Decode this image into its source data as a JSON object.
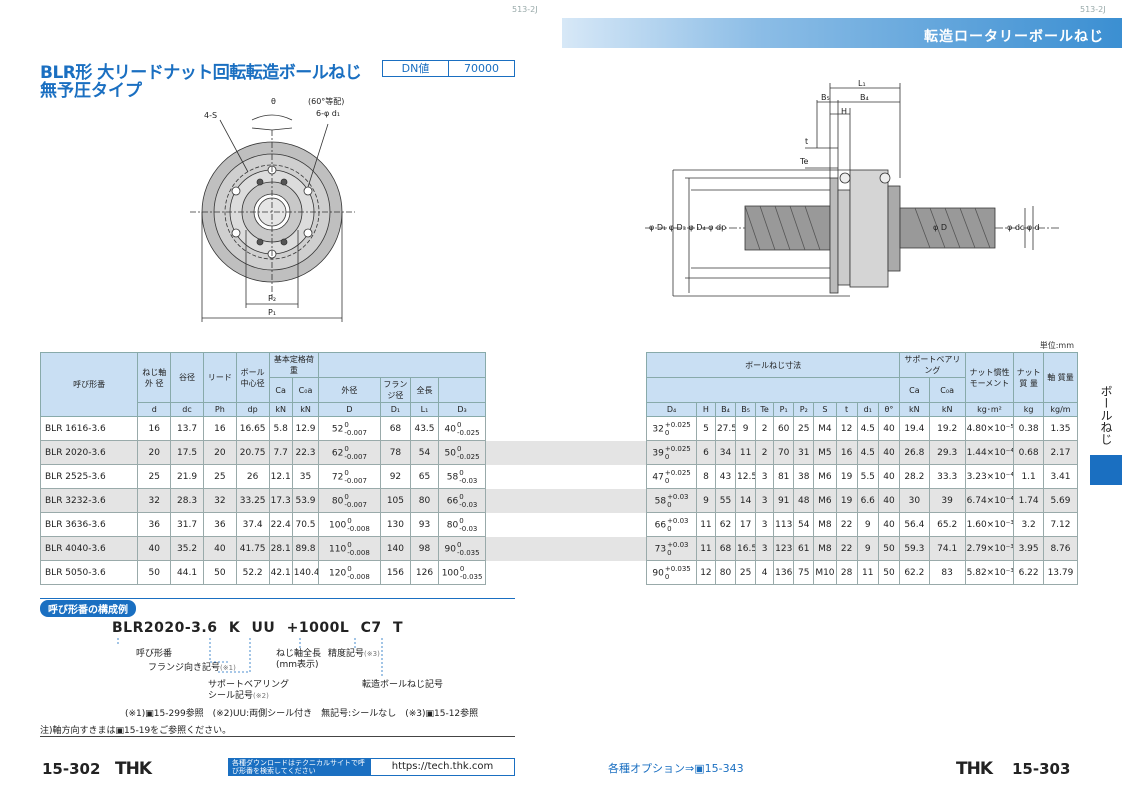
{
  "header": {
    "page_code_left": "513-2J",
    "page_code_right": "513-2J",
    "category": "転造ロータリーボールねじ"
  },
  "title": {
    "line1": "BLR形 大リードナット回転転造ボールねじ",
    "line2": "無予圧タイプ",
    "dn_label": "DN値",
    "dn_value": "70000"
  },
  "front_view": {
    "theta": "θ",
    "equal_division": "(60°等配)",
    "holes": "6-φ d₁",
    "screws": "4-S",
    "p2": "P₂",
    "p1": "P₁"
  },
  "side_view": {
    "L1": "L₁",
    "B5": "B₅",
    "B4": "B₄",
    "H": "H",
    "t": "t",
    "Te": "Te",
    "left_dims": "φ D₁ φ D₃ φ D₄ φ dp",
    "right_D": "φ D",
    "right_dims": "φ dc φ d"
  },
  "unit": "単位:mm",
  "table": {
    "headers": {
      "model": "呼び形番",
      "shaft_od": "ねじ軸 外 径",
      "root_dia": "谷径",
      "lead": "リード",
      "ball_center": "ボール 中心径",
      "basic_load": "基本定格荷重",
      "outer_dia": "外径",
      "flange_dia": "フランジ径",
      "total_len": "全長",
      "ballscrew_dims": "ボールねじ寸法",
      "support_bearing": "サポートベアリング",
      "support_basic_load": "基本定格荷重",
      "inertia": "ナット慣性 モーメント",
      "nut_mass": "ナット 質 量",
      "shaft_mass": "軸 質量",
      "Ca": "Ca",
      "C0a": "C₀a",
      "sym_d": "d",
      "sym_dc": "dc",
      "sym_Ph": "Ph",
      "sym_dp": "dp",
      "kN": "kN",
      "sym_D": "D",
      "sym_D1": "D₁",
      "sym_L1": "L₁",
      "sym_D3": "D₃",
      "sym_D4": "D₄",
      "sym_H": "H",
      "sym_B4": "B₄",
      "sym_B5": "B₅",
      "sym_Te": "Te",
      "sym_P1": "P₁",
      "sym_P2": "P₂",
      "sym_S": "S",
      "sym_t": "t",
      "sym_d1": "d₁",
      "sym_theta": "θ°",
      "kgm2": "kg･m²",
      "kg": "kg",
      "kgm": "kg/m"
    },
    "rows": [
      {
        "model": "BLR 1616-3.6",
        "d": "16",
        "dc": "13.7",
        "Ph": "16",
        "dp": "16.65",
        "Ca": "5.8",
        "C0a": "12.9",
        "D": "52",
        "D_tol_up": "0",
        "D_tol_lo": "-0.007",
        "D1": "68",
        "L1": "43.5",
        "D3": "40",
        "D3_tol_up": "0",
        "D3_tol_lo": "-0.025",
        "D4": "32",
        "D4_tol_up": "+0.025",
        "D4_tol_lo": "0",
        "H": "5",
        "B4": "27.5",
        "B5": "9",
        "Te": "2",
        "P1": "60",
        "P2": "25",
        "S": "M4",
        "t": "12",
        "d1": "4.5",
        "theta": "40",
        "sCa": "19.4",
        "sC0a": "19.2",
        "inertia": "4.80×10⁻⁵",
        "nut_mass": "0.38",
        "shaft_mass": "1.35"
      },
      {
        "model": "BLR 2020-3.6",
        "d": "20",
        "dc": "17.5",
        "Ph": "20",
        "dp": "20.75",
        "Ca": "7.7",
        "C0a": "22.3",
        "D": "62",
        "D_tol_up": "0",
        "D_tol_lo": "-0.007",
        "D1": "78",
        "L1": "54",
        "D3": "50",
        "D3_tol_up": "0",
        "D3_tol_lo": "-0.025",
        "D4": "39",
        "D4_tol_up": "+0.025",
        "D4_tol_lo": "0",
        "H": "6",
        "B4": "34",
        "B5": "11",
        "Te": "2",
        "P1": "70",
        "P2": "31",
        "S": "M5",
        "t": "16",
        "d1": "4.5",
        "theta": "40",
        "sCa": "26.8",
        "sC0a": "29.3",
        "inertia": "1.44×10⁻⁴",
        "nut_mass": "0.68",
        "shaft_mass": "2.17"
      },
      {
        "model": "BLR 2525-3.6",
        "d": "25",
        "dc": "21.9",
        "Ph": "25",
        "dp": "26",
        "Ca": "12.1",
        "C0a": "35",
        "D": "72",
        "D_tol_up": "0",
        "D_tol_lo": "-0.007",
        "D1": "92",
        "L1": "65",
        "D3": "58",
        "D3_tol_up": "0",
        "D3_tol_lo": "-0.03",
        "D4": "47",
        "D4_tol_up": "+0.025",
        "D4_tol_lo": "0",
        "H": "8",
        "B4": "43",
        "B5": "12.5",
        "Te": "3",
        "P1": "81",
        "P2": "38",
        "S": "M6",
        "t": "19",
        "d1": "5.5",
        "theta": "40",
        "sCa": "28.2",
        "sC0a": "33.3",
        "inertia": "3.23×10⁻⁴",
        "nut_mass": "1.1",
        "shaft_mass": "3.41"
      },
      {
        "model": "BLR 3232-3.6",
        "d": "32",
        "dc": "28.3",
        "Ph": "32",
        "dp": "33.25",
        "Ca": "17.3",
        "C0a": "53.9",
        "D": "80",
        "D_tol_up": "0",
        "D_tol_lo": "-0.007",
        "D1": "105",
        "L1": "80",
        "D3": "66",
        "D3_tol_up": "0",
        "D3_tol_lo": "-0.03",
        "D4": "58",
        "D4_tol_up": "+0.03",
        "D4_tol_lo": "0",
        "H": "9",
        "B4": "55",
        "B5": "14",
        "Te": "3",
        "P1": "91",
        "P2": "48",
        "S": "M6",
        "t": "19",
        "d1": "6.6",
        "theta": "40",
        "sCa": "30",
        "sC0a": "39",
        "inertia": "6.74×10⁻⁴",
        "nut_mass": "1.74",
        "shaft_mass": "5.69"
      },
      {
        "model": "BLR 3636-3.6",
        "d": "36",
        "dc": "31.7",
        "Ph": "36",
        "dp": "37.4",
        "Ca": "22.4",
        "C0a": "70.5",
        "D": "100",
        "D_tol_up": "0",
        "D_tol_lo": "-0.008",
        "D1": "130",
        "L1": "93",
        "D3": "80",
        "D3_tol_up": "0",
        "D3_tol_lo": "-0.03",
        "D4": "66",
        "D4_tol_up": "+0.03",
        "D4_tol_lo": "0",
        "H": "11",
        "B4": "62",
        "B5": "17",
        "Te": "3",
        "P1": "113",
        "P2": "54",
        "S": "M8",
        "t": "22",
        "d1": "9",
        "theta": "40",
        "sCa": "56.4",
        "sC0a": "65.2",
        "inertia": "1.60×10⁻³",
        "nut_mass": "3.2",
        "shaft_mass": "7.12"
      },
      {
        "model": "BLR 4040-3.6",
        "d": "40",
        "dc": "35.2",
        "Ph": "40",
        "dp": "41.75",
        "Ca": "28.1",
        "C0a": "89.8",
        "D": "110",
        "D_tol_up": "0",
        "D_tol_lo": "-0.008",
        "D1": "140",
        "L1": "98",
        "D3": "90",
        "D3_tol_up": "0",
        "D3_tol_lo": "-0.035",
        "D4": "73",
        "D4_tol_up": "+0.03",
        "D4_tol_lo": "0",
        "H": "11",
        "B4": "68",
        "B5": "16.5",
        "Te": "3",
        "P1": "123",
        "P2": "61",
        "S": "M8",
        "t": "22",
        "d1": "9",
        "theta": "50",
        "sCa": "59.3",
        "sC0a": "74.1",
        "inertia": "2.79×10⁻³",
        "nut_mass": "3.95",
        "shaft_mass": "8.76"
      },
      {
        "model": "BLR 5050-3.6",
        "d": "50",
        "dc": "44.1",
        "Ph": "50",
        "dp": "52.2",
        "Ca": "42.1",
        "C0a": "140.4",
        "D": "120",
        "D_tol_up": "0",
        "D_tol_lo": "-0.008",
        "D1": "156",
        "L1": "126",
        "D3": "100",
        "D3_tol_up": "0",
        "D3_tol_lo": "-0.035",
        "D4": "90",
        "D4_tol_up": "+0.035",
        "D4_tol_lo": "0",
        "H": "12",
        "B4": "80",
        "B5": "25",
        "Te": "4",
        "P1": "136",
        "P2": "75",
        "S": "M10",
        "t": "28",
        "d1": "11",
        "theta": "50",
        "sCa": "62.2",
        "sC0a": "83",
        "inertia": "5.82×10⁻³",
        "nut_mass": "6.22",
        "shaft_mass": "13.79"
      }
    ]
  },
  "side_tab": "ボールねじ",
  "example": {
    "badge": "呼び形番の構成例",
    "code": "BLR2020-3.6  K  UU  +1000L  C7  T",
    "model_no": "呼び形番",
    "flange_symbol": "フランジ向き記号",
    "note1": "(※1)",
    "shaft_length": "ねじ軸全長",
    "mm_note": "(mm表示)",
    "accuracy": "精度記号",
    "note3": "(※3)",
    "support_bearing": "サポートベアリング",
    "seal_symbol": "シール記号",
    "note2": "(※2)",
    "rolled": "転造ボールねじ記号"
  },
  "footnotes": {
    "line1": "(※1)▣15-299参照　(※2)UU:両側シール付き　無記号:シールなし　(※3)▣15-12参照",
    "line2": "注)軸方向すきまは▣15-19をご参照ください。"
  },
  "footer": {
    "left_page": "15-302",
    "right_page": "15-303",
    "brand": "THK",
    "download_text": "各種ダウンロードはテクニカルサイトで呼び形番を検索してください",
    "url": "https://tech.thk.com",
    "options": "各種オプション⇒▣15-343"
  }
}
